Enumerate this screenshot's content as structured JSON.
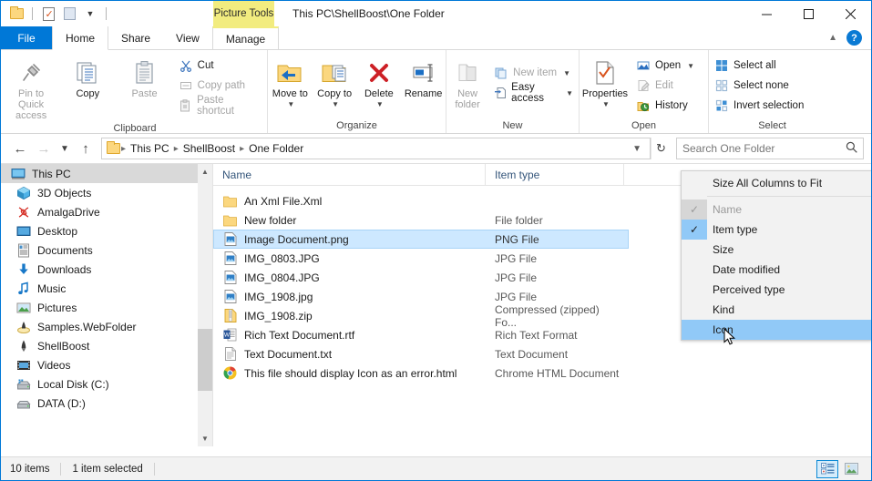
{
  "window": {
    "title": "This PC\\ShellBoost\\One Folder",
    "contextual_tab_group": "Picture Tools",
    "minimize_label": "Minimize",
    "maximize_label": "Maximize",
    "close_label": "Close"
  },
  "quick_access_toolbar": {
    "items": [
      {
        "name": "folder-icon",
        "label": "Folder"
      },
      {
        "name": "properties-icon",
        "label": "Properties"
      },
      {
        "name": "new-folder-icon",
        "label": "New folder"
      },
      {
        "name": "customize-caret",
        "label": "Customize Quick Access Toolbar"
      }
    ]
  },
  "tabs": [
    {
      "label": "File",
      "state": "file"
    },
    {
      "label": "Home",
      "state": "active"
    },
    {
      "label": "Share",
      "state": "normal"
    },
    {
      "label": "View",
      "state": "normal"
    },
    {
      "label": "Manage",
      "state": "contextual"
    }
  ],
  "ribbon": {
    "groups": [
      {
        "name": "clipboard",
        "label": "Clipboard",
        "big_buttons": [
          {
            "label": "Pin to Quick access",
            "icon": "pin-icon",
            "disabled": true
          },
          {
            "label": "Copy",
            "icon": "copy-icon",
            "disabled": false
          },
          {
            "label": "Paste",
            "icon": "paste-icon",
            "disabled": true
          }
        ],
        "small_buttons": [
          {
            "label": "Cut",
            "icon": "scissors-icon",
            "disabled": false
          },
          {
            "label": "Copy path",
            "icon": "copy-path-icon",
            "disabled": true
          },
          {
            "label": "Paste shortcut",
            "icon": "paste-shortcut-icon",
            "disabled": true
          }
        ]
      },
      {
        "name": "organize",
        "label": "Organize",
        "big_buttons": [
          {
            "label": "Move to",
            "icon": "move-to-icon",
            "dropdown": true
          },
          {
            "label": "Copy to",
            "icon": "copy-to-icon",
            "dropdown": true
          },
          {
            "label": "Delete",
            "icon": "delete-icon",
            "dropdown": true
          },
          {
            "label": "Rename",
            "icon": "rename-icon",
            "dropdown": false
          }
        ]
      },
      {
        "name": "new",
        "label": "New",
        "big_buttons": [
          {
            "label": "New folder",
            "icon": "new-folder-icon",
            "disabled": true
          }
        ],
        "small_buttons": [
          {
            "label": "New item",
            "icon": "new-item-icon",
            "disabled": true,
            "dropdown": true
          },
          {
            "label": "Easy access",
            "icon": "easy-access-icon",
            "disabled": false,
            "dropdown": true
          }
        ]
      },
      {
        "name": "open",
        "label": "Open",
        "big_buttons": [
          {
            "label": "Properties",
            "icon": "properties-icon",
            "dropdown": true
          }
        ],
        "small_buttons": [
          {
            "label": "Open",
            "icon": "open-icon",
            "disabled": false,
            "dropdown": true
          },
          {
            "label": "Edit",
            "icon": "edit-icon",
            "disabled": true
          },
          {
            "label": "History",
            "icon": "history-icon",
            "disabled": false
          }
        ]
      },
      {
        "name": "select",
        "label": "Select",
        "small_buttons": [
          {
            "label": "Select all",
            "icon": "select-all-icon"
          },
          {
            "label": "Select none",
            "icon": "select-none-icon"
          },
          {
            "label": "Invert selection",
            "icon": "invert-selection-icon"
          }
        ]
      }
    ]
  },
  "address_bar": {
    "back_label": "Back",
    "forward_label": "Forward",
    "recent_label": "Recent locations",
    "up_label": "Up",
    "refresh_label": "Refresh",
    "breadcrumbs": [
      "This PC",
      "ShellBoost",
      "One Folder"
    ],
    "search_placeholder": "Search One Folder"
  },
  "nav_pane": {
    "items": [
      {
        "label": "This PC",
        "icon": "this-pc-icon",
        "selected": true,
        "root": true
      },
      {
        "label": "3D Objects",
        "icon": "3d-objects-icon",
        "selected": false
      },
      {
        "label": "AmalgaDrive",
        "icon": "amalgadrive-icon",
        "selected": false
      },
      {
        "label": "Desktop",
        "icon": "desktop-icon",
        "selected": false
      },
      {
        "label": "Documents",
        "icon": "documents-icon",
        "selected": false
      },
      {
        "label": "Downloads",
        "icon": "downloads-icon",
        "selected": false
      },
      {
        "label": "Music",
        "icon": "music-icon",
        "selected": false
      },
      {
        "label": "Pictures",
        "icon": "pictures-icon",
        "selected": false
      },
      {
        "label": "Samples.WebFolder",
        "icon": "webfolder-icon",
        "selected": false
      },
      {
        "label": "ShellBoost",
        "icon": "shellboost-icon",
        "selected": false
      },
      {
        "label": "Videos",
        "icon": "videos-icon",
        "selected": false
      },
      {
        "label": "Local Disk (C:)",
        "icon": "local-disk-icon",
        "selected": false
      },
      {
        "label": "DATA (D:)",
        "icon": "data-disk-icon",
        "selected": false
      }
    ]
  },
  "file_list": {
    "columns": [
      {
        "label": "Name",
        "key": "name"
      },
      {
        "label": "Item type",
        "key": "type"
      }
    ],
    "rows": [
      {
        "name": "An Xml File.Xml",
        "type": "",
        "icon": "folder-icon",
        "selected": false
      },
      {
        "name": "New folder",
        "type": "File folder",
        "icon": "folder-icon",
        "selected": false
      },
      {
        "name": "Image Document.png",
        "type": "PNG File",
        "icon": "image-file-icon",
        "selected": true
      },
      {
        "name": "IMG_0803.JPG",
        "type": "JPG File",
        "icon": "image-file-icon",
        "selected": false
      },
      {
        "name": "IMG_0804.JPG",
        "type": "JPG File",
        "icon": "image-file-icon",
        "selected": false
      },
      {
        "name": "IMG_1908.jpg",
        "type": "JPG File",
        "icon": "image-file-icon",
        "selected": false
      },
      {
        "name": "IMG_1908.zip",
        "type": "Compressed (zipped) Fo...",
        "icon": "zip-file-icon",
        "selected": false
      },
      {
        "name": "Rich Text Document.rtf",
        "type": "Rich Text Format",
        "icon": "rtf-file-icon",
        "selected": false
      },
      {
        "name": "Text Document.txt",
        "type": "Text Document",
        "icon": "txt-file-icon",
        "selected": false
      },
      {
        "name": "This file should display Icon as an error.html",
        "type": "Chrome HTML Document",
        "icon": "chrome-file-icon",
        "selected": false
      }
    ]
  },
  "context_menu": {
    "top_item": {
      "label": "Size All Columns to Fit"
    },
    "items": [
      {
        "label": "Name",
        "checked": true,
        "disabled": true,
        "highlighted": false
      },
      {
        "label": "Item type",
        "checked": true,
        "disabled": false,
        "highlighted": false
      },
      {
        "label": "Size",
        "checked": false,
        "disabled": false,
        "highlighted": false
      },
      {
        "label": "Date modified",
        "checked": false,
        "disabled": false,
        "highlighted": false
      },
      {
        "label": "Perceived type",
        "checked": false,
        "disabled": false,
        "highlighted": false
      },
      {
        "label": "Kind",
        "checked": false,
        "disabled": false,
        "highlighted": false
      },
      {
        "label": "Icon",
        "checked": false,
        "disabled": false,
        "highlighted": true
      }
    ]
  },
  "status_bar": {
    "item_count": "10 items",
    "selection_info": "1 item selected",
    "view_buttons": [
      {
        "name": "details-view-button",
        "label": "Details view",
        "active": true
      },
      {
        "name": "large-icons-view-button",
        "label": "Large icons view",
        "active": false
      }
    ]
  },
  "colors": {
    "accent": "#0078d7",
    "selection": "#cde8ff",
    "menu_highlight": "#91c9f7",
    "contextual_tab": "#f2ec7f",
    "nav_selected": "#d9d9d9"
  }
}
